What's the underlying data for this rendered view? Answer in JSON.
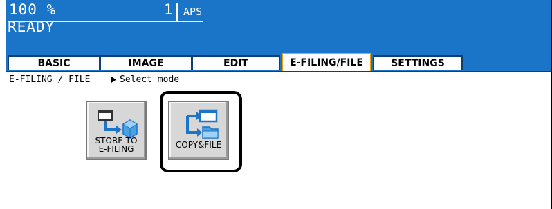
{
  "header": {
    "zoom": "100 %",
    "copies": "1",
    "paper_mode": "APS",
    "status": "READY"
  },
  "tabs": [
    {
      "label": "BASIC",
      "active": false
    },
    {
      "label": "IMAGE",
      "active": false
    },
    {
      "label": "EDIT",
      "active": false
    },
    {
      "label": "E-FILING/FILE",
      "active": true
    },
    {
      "label": "SETTINGS",
      "active": false
    }
  ],
  "breadcrumb": {
    "section": "E-FILING / FILE",
    "message": "Select mode"
  },
  "buttons": {
    "store": {
      "label_line1": "STORE TO",
      "label_line2": "E-FILING",
      "icon": "store-to-efiling-icon"
    },
    "copy_file": {
      "label": "COPY&FILE",
      "icon": "copy-and-file-icon",
      "selected": true
    }
  },
  "colors": {
    "header_bg": "#1a74c7",
    "tab_border": "#0a3f7a",
    "active_tab_border": "#f2a200",
    "button_face": "#d7d7d7",
    "icon_blue": "#1a74c7"
  }
}
